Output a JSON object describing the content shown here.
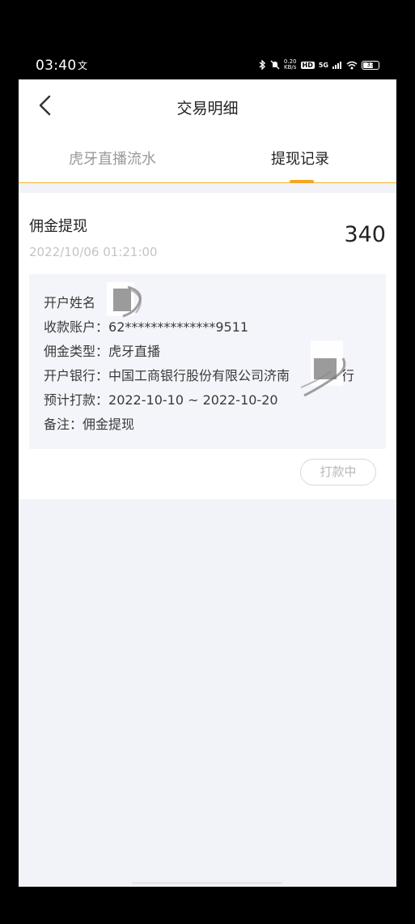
{
  "status_bar": {
    "time": "03:40",
    "left_icon": "文",
    "net_speed_value": "0.20",
    "net_speed_unit": "KB/s",
    "hd_label": "HD",
    "signal_label": "5G",
    "battery_level": "33"
  },
  "header": {
    "title": "交易明细",
    "back_icon": "chevron-left-icon"
  },
  "tabs": [
    {
      "label": "虎牙直播流水",
      "active": false
    },
    {
      "label": "提现记录",
      "active": true
    }
  ],
  "record": {
    "title": "佣金提现",
    "amount": "340",
    "datetime": "2022/10/06 01:21:00",
    "details": [
      {
        "label": "开户姓名",
        "value": ""
      },
      {
        "label": "收款账户：",
        "value": "62**************9511"
      },
      {
        "label": "佣金类型：",
        "value": "虎牙直播"
      },
      {
        "label": "开户银行：",
        "value": "中国工商银行股份有限公司济南"
      },
      {
        "label": "",
        "value": "行"
      },
      {
        "label": "预计打款：",
        "value": "2022-10-10 ~ 2022-10-20"
      },
      {
        "label": "备注：",
        "value": "佣金提现"
      }
    ],
    "status_button": "打款中"
  },
  "colors": {
    "accent": "#f5a623",
    "tab_border": "#f5b525",
    "page_bg": "#f2f3f8",
    "detail_bg": "#f4f5fa"
  }
}
